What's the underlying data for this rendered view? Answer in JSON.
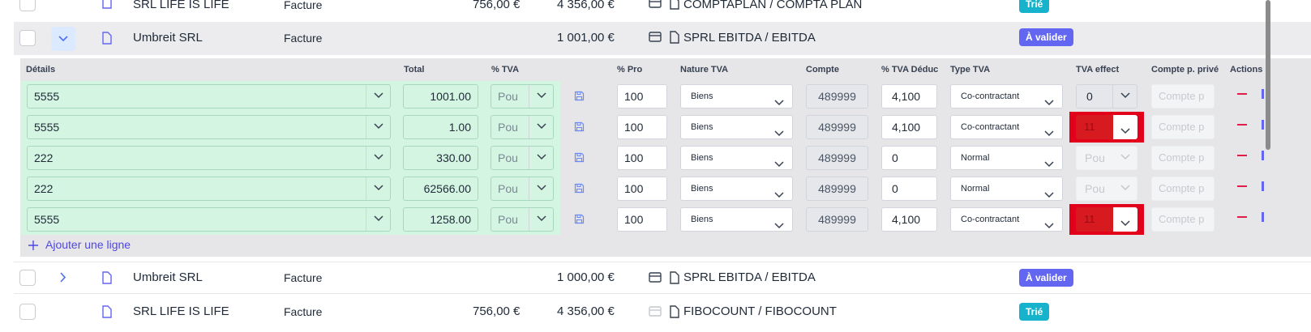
{
  "colors": {
    "accent": "#6366f1",
    "valid": "#17b3cc",
    "error": "#e3001b",
    "row_green": "#d5f5e3"
  },
  "rows": [
    {
      "supplier": "SRL LIFE IS LIFE",
      "type": "Facture",
      "amount_ht": "756,00 €",
      "amount": "4 356,00 €",
      "account": "COMPTAPLAN / COMPTA PLAN",
      "status": "Trié"
    },
    {
      "supplier": "Umbreit SRL",
      "type": "Facture",
      "amount_ht": "",
      "amount": "1 001,00 €",
      "account": "SPRL EBITDA / EBITDA",
      "status": "À valider"
    },
    {
      "supplier": "Umbreit SRL",
      "type": "Facture",
      "amount_ht": "",
      "amount": "1 000,00 €",
      "account": "SPRL EBITDA / EBITDA",
      "status": "À valider"
    },
    {
      "supplier": "SRL LIFE IS LIFE",
      "type": "Facture",
      "amount_ht": "756,00 €",
      "amount": "4 356,00 €",
      "account": "FIBOCOUNT / FIBOCOUNT",
      "status": "Trié"
    }
  ],
  "detail_headers": {
    "details": "Détails",
    "total": "Total",
    "tva": "% TVA",
    "pro": "% Pro",
    "nature": "Nature TVA",
    "compte": "Compte",
    "tva_deduc": "% TVA Déduc",
    "type_tva": "Type TVA",
    "tva_effect": "TVA effect",
    "compte_prive": "Compte p. privé",
    "actions": "Actions"
  },
  "lines": [
    {
      "detail": "5555",
      "total": "1001.00",
      "tva": "Pou",
      "pro": "100",
      "nature": "Biens",
      "compte": "489999",
      "deduc": "4,100",
      "type": "Co-contractant",
      "effect": "0",
      "prive": "Compte p"
    },
    {
      "detail": "5555",
      "total": "1.00",
      "tva": "Pou",
      "pro": "100",
      "nature": "Biens",
      "compte": "489999",
      "deduc": "4,100",
      "type": "Co-contractant",
      "effect": "11",
      "prive": "Compte p"
    },
    {
      "detail": "222",
      "total": "330.00",
      "tva": "Pou",
      "pro": "100",
      "nature": "Biens",
      "compte": "489999",
      "deduc": "0",
      "type": "Normal",
      "effect": "Pou",
      "prive": "Compte p"
    },
    {
      "detail": "222",
      "total": "62566.00",
      "tva": "Pou",
      "pro": "100",
      "nature": "Biens",
      "compte": "489999",
      "deduc": "0",
      "type": "Normal",
      "effect": "Pou",
      "prive": "Compte p"
    },
    {
      "detail": "5555",
      "total": "1258.00",
      "tva": "Pou",
      "pro": "100",
      "nature": "Biens",
      "compte": "489999",
      "deduc": "4,100",
      "type": "Co-contractant",
      "effect": "11",
      "prive": "Compte p"
    }
  ],
  "add_line_label": "Ajouter une ligne",
  "icons": {
    "doc": "document-icon",
    "card": "credit-card-icon",
    "save": "save-icon",
    "chevron": "chevron-down-icon",
    "minus": "minus-icon",
    "plus": "plus-icon"
  }
}
